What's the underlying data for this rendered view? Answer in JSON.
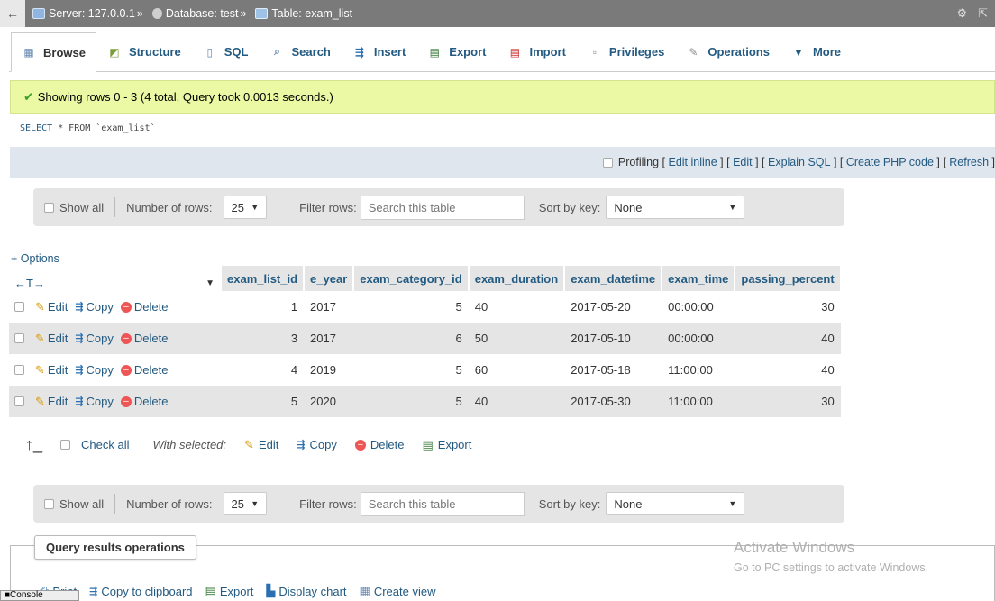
{
  "breadcrumb": {
    "server": "Server: 127.0.0.1",
    "database": "Database: test",
    "table": "Table: exam_list",
    "sep": "»"
  },
  "tabs": [
    {
      "label": "Browse",
      "icon": "browse-icon"
    },
    {
      "label": "Structure",
      "icon": "structure-icon"
    },
    {
      "label": "SQL",
      "icon": "sql-icon"
    },
    {
      "label": "Search",
      "icon": "search-icon"
    },
    {
      "label": "Insert",
      "icon": "insert-icon"
    },
    {
      "label": "Export",
      "icon": "export-icon"
    },
    {
      "label": "Import",
      "icon": "import-icon"
    },
    {
      "label": "Privileges",
      "icon": "privileges-icon"
    },
    {
      "label": "Operations",
      "icon": "operations-icon"
    },
    {
      "label": "More",
      "icon": "chevron-down-icon"
    }
  ],
  "message": "Showing rows 0 - 3 (4 total, Query took 0.0013 seconds.)",
  "sql": {
    "keyword": "SELECT",
    "rest": " * FROM `exam_list`"
  },
  "profiling": {
    "label": "Profiling",
    "edit_inline": "Edit inline",
    "edit": "Edit",
    "explain": "Explain SQL",
    "php": "Create PHP code",
    "refresh": "Refresh"
  },
  "nav": {
    "show_all": "Show all",
    "rows_label": "Number of rows:",
    "rows_value": "25",
    "filter_label": "Filter rows:",
    "filter_placeholder": "Search this table",
    "sort_label": "Sort by key:",
    "sort_value": "None"
  },
  "options_link": "+ Options",
  "table": {
    "columns": [
      "exam_list_id",
      "e_year",
      "exam_category_id",
      "exam_duration",
      "exam_datetime",
      "exam_time",
      "passing_percent"
    ],
    "action_labels": {
      "edit": "Edit",
      "copy": "Copy",
      "delete": "Delete"
    },
    "rows": [
      [
        "1",
        "2017",
        "5",
        "40",
        "2017-05-20",
        "00:00:00",
        "30"
      ],
      [
        "3",
        "2017",
        "6",
        "50",
        "2017-05-10",
        "00:00:00",
        "40"
      ],
      [
        "4",
        "2019",
        "5",
        "60",
        "2017-05-18",
        "11:00:00",
        "40"
      ],
      [
        "5",
        "2020",
        "5",
        "40",
        "2017-05-30",
        "11:00:00",
        "30"
      ]
    ]
  },
  "bulk": {
    "check_all": "Check all",
    "with_selected": "With selected:",
    "edit": "Edit",
    "copy": "Copy",
    "delete": "Delete",
    "export": "Export"
  },
  "qro": {
    "title": "Query results operations",
    "print": "Print",
    "clipboard": "Copy to clipboard",
    "export": "Export",
    "chart": "Display chart",
    "view": "Create view"
  },
  "console": "Console",
  "watermark": {
    "line1": "Activate Windows",
    "line2": "Go to PC settings to activate Windows."
  }
}
